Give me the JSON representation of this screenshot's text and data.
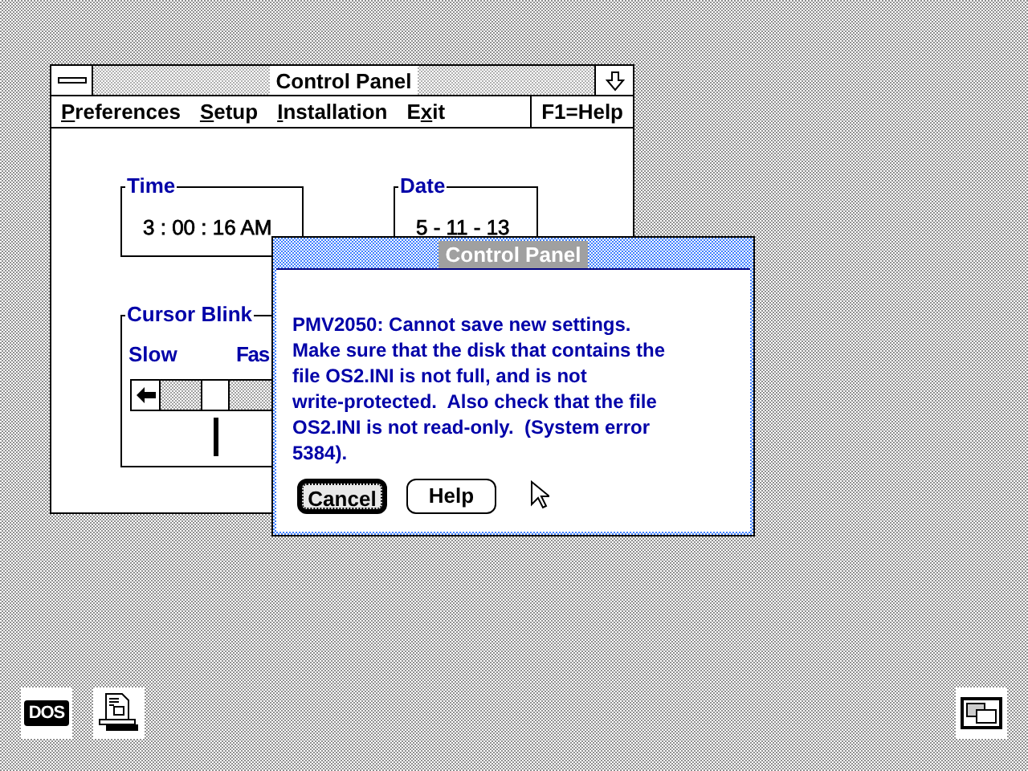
{
  "window": {
    "title": "Control Panel"
  },
  "menu": [
    {
      "mnemonic": "P",
      "suffix": "references"
    },
    {
      "mnemonic": "S",
      "suffix": "etup"
    },
    {
      "mnemonic": "I",
      "suffix": "nstallation"
    },
    {
      "prefix": "E",
      "mnemonic": "x",
      "suffix": "it"
    }
  ],
  "help_hint": "F1=Help",
  "time": {
    "label": "Time",
    "value": "3 : 00 : 16 AM"
  },
  "date": {
    "label": "Date",
    "value": "5 - 11 - 13"
  },
  "cursor_blink": {
    "label": "Cursor Blink",
    "slow": "Slow",
    "fast": "Fas"
  },
  "dialog": {
    "title": "Control Panel",
    "message": "PMV2050: Cannot save new settings.\nMake sure that the disk that contains the\nfile OS2.INI is not full, and is not\nwrite-protected.  Also check that the file\nOS2.INI is not read-only.  (System error\n5384).",
    "buttons": [
      {
        "label": "Cancel",
        "selected": true
      },
      {
        "label": "Help",
        "selected": false
      }
    ]
  },
  "desktop_icons": [
    {
      "kind": "dos",
      "label": "DOS"
    },
    {
      "kind": "printer"
    },
    {
      "kind": "windows"
    }
  ]
}
